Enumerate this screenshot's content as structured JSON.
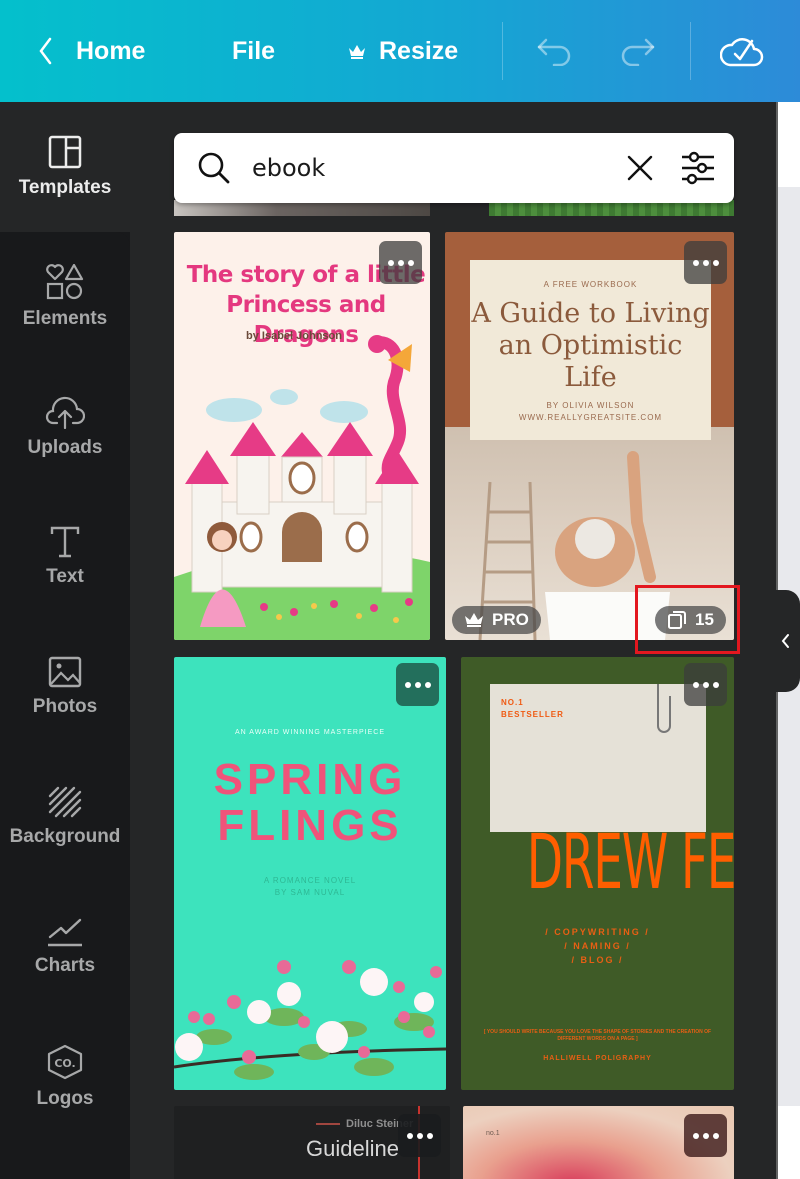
{
  "topbar": {
    "home_label": "Home",
    "file_label": "File",
    "resize_label": "Resize",
    "icons": [
      "chevron-left-icon",
      "crown-icon",
      "undo-icon",
      "redo-icon",
      "cloud-check-icon"
    ]
  },
  "sidebar": {
    "items": [
      {
        "label": "Templates",
        "icon": "templates-icon",
        "active": true
      },
      {
        "label": "Elements",
        "icon": "elements-icon",
        "active": false
      },
      {
        "label": "Uploads",
        "icon": "upload-cloud-icon",
        "active": false
      },
      {
        "label": "Text",
        "icon": "text-icon",
        "active": false
      },
      {
        "label": "Photos",
        "icon": "photo-icon",
        "active": false
      },
      {
        "label": "Background",
        "icon": "background-icon",
        "active": false
      },
      {
        "label": "Charts",
        "icon": "chart-icon",
        "active": false
      },
      {
        "label": "Logos",
        "icon": "logo-icon",
        "active": false
      }
    ]
  },
  "search": {
    "value": "ebook",
    "icons": [
      "search-icon",
      "clear-icon",
      "filter-icon"
    ]
  },
  "templates": [
    {
      "title": "The story of a little Princess and Dragons",
      "author": "by Isabel Johnson"
    },
    {
      "kicker": "A FREE WORKBOOK",
      "title": "A Guide to Living an Optimistic Life",
      "byline": "BY OLIVIA WILSON",
      "site": "WWW.REALLYGREATSITE.COM",
      "pro_label": "PRO",
      "page_count": "15"
    },
    {
      "kicker": "AN AWARD WINNING MASTERPIECE",
      "title_line1": "SPRING",
      "title_line2": "FLINGS",
      "sub_line1": "A ROMANCE NOVEL",
      "sub_line2": "BY SAM NUVAL"
    },
    {
      "tag_line1": "NO.1",
      "tag_line2": "BESTSELLER",
      "title": "DREW FEIG",
      "list1": "/ COPYWRITING /",
      "list2": "/ NAMING /",
      "list3": "/ BLOG /",
      "quote": "[ YOU SHOULD WRITE BECAUSE YOU LOVE THE SHAPE OF STORIES AND THE CREATION OF DIFFERENT WORDS ON A PAGE ]",
      "press": "HALLIWELL POLIGRAPHY"
    },
    {
      "name": "Diluc Steiner",
      "title": "Guideline"
    },
    {
      "label": "no.1"
    }
  ],
  "colors": {
    "topbar_start": "#04c0cc",
    "topbar_end": "#2d8bd8",
    "sidebar_bg": "#18191b",
    "panel_bg": "#252627",
    "highlight": "#e3171f"
  }
}
